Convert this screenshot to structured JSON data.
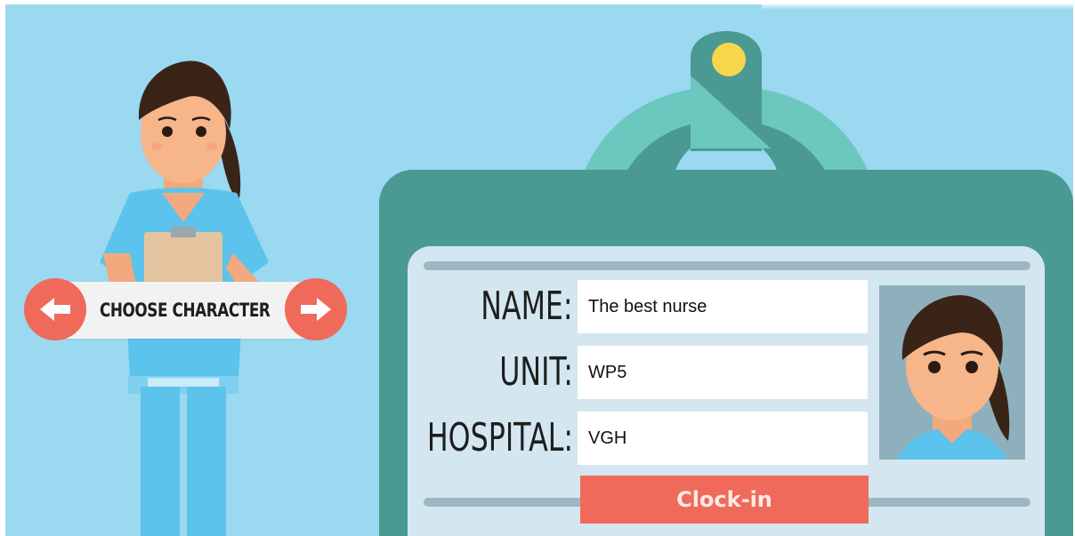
{
  "character_selector": {
    "label": "CHOOSE CHARACTER",
    "prev_icon": "arrow-left-icon",
    "next_icon": "arrow-right-icon"
  },
  "id_card": {
    "name_label": "NAME:",
    "name_value": "The best nurse",
    "unit_label": "UNIT:",
    "unit_value": "WP5",
    "hospital_label": "HOSPITAL:",
    "hospital_value": "VGH",
    "clockin_label": "Clock-in"
  },
  "colors": {
    "background": "#9ad9f0",
    "badge": "#4a9a93",
    "card": "#d4e7f1",
    "accent": "#ef6a5a",
    "scrubs": "#5cc3ec"
  }
}
